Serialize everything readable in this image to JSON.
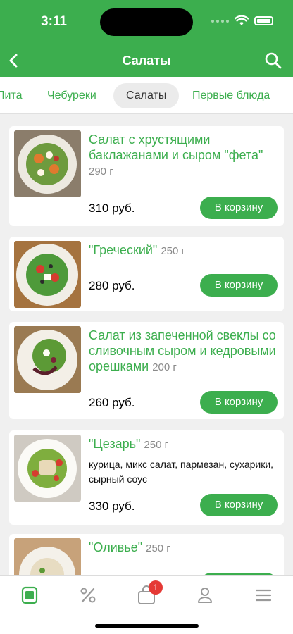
{
  "status_bar": {
    "time": "3:11"
  },
  "nav": {
    "title": "Салаты"
  },
  "tabs": [
    {
      "label": "Пита"
    },
    {
      "label": "Чебуреки"
    },
    {
      "label": "Салаты"
    },
    {
      "label": "Первые блюда"
    }
  ],
  "products": [
    {
      "title": "Салат с хрустящими баклажанами и сыром \"фета\"",
      "weight": "290 г",
      "description": "",
      "price": "310 руб.",
      "button": "В корзину"
    },
    {
      "title": "\"Греческий\"",
      "weight": "250 г",
      "description": "",
      "price": "280 руб.",
      "button": "В корзину"
    },
    {
      "title": "Салат из запеченной свеклы со сливочным сыром и кедровыми орешками",
      "weight": "200 г",
      "description": "",
      "price": "260 руб.",
      "button": "В корзину"
    },
    {
      "title": "\"Цезарь\"",
      "weight": "250 г",
      "description": "курица, микс салат, пармезан, сухарики, сырный соус",
      "price": "330 руб.",
      "button": "В корзину"
    },
    {
      "title": "\"Оливье\"",
      "weight": "250 г",
      "description": "",
      "price": "",
      "button": ""
    }
  ],
  "tabbar": {
    "items": [
      {
        "icon": "menu-home-icon"
      },
      {
        "icon": "percent-icon"
      },
      {
        "icon": "shopping-bag-icon"
      },
      {
        "icon": "profile-icon"
      },
      {
        "icon": "hamburger-menu-icon"
      }
    ],
    "cart_badge": "1"
  },
  "colors": {
    "accent": "#3cae4e",
    "badge": "#e53935"
  }
}
